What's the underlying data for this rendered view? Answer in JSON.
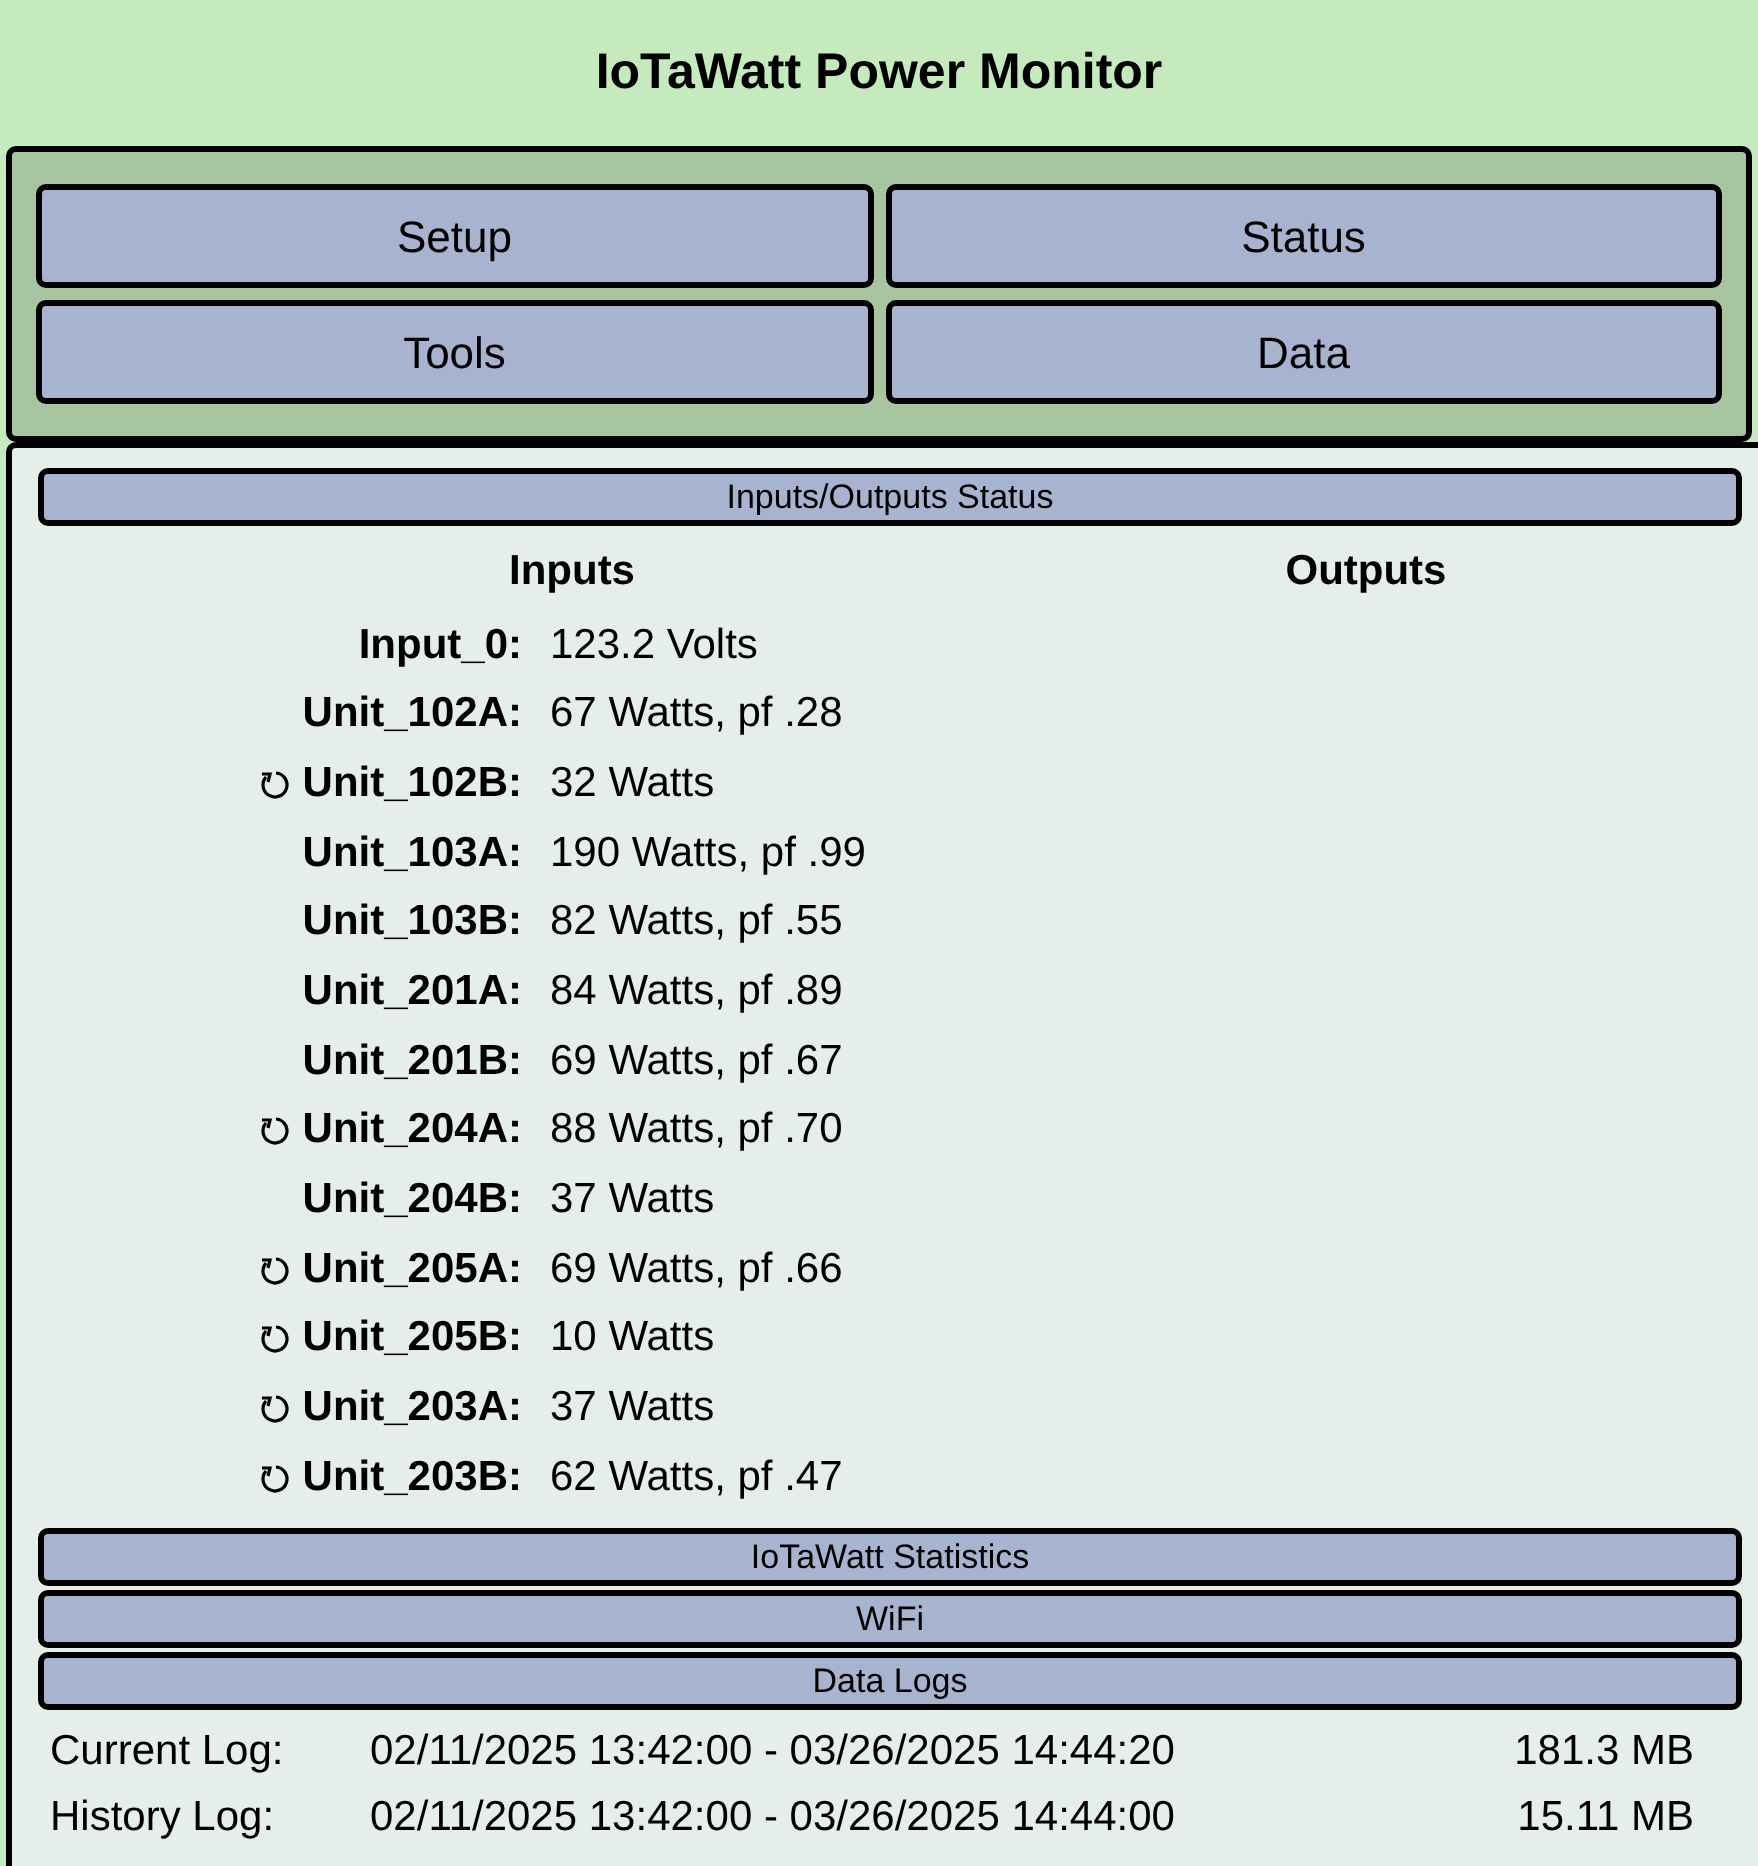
{
  "window": {
    "title": "IoTaWatt Power Monitor"
  },
  "menu": [
    "Setup",
    "Status",
    "Tools",
    "Data"
  ],
  "io_status": {
    "header": "Inputs/Outputs Status",
    "inputs_heading": "Inputs",
    "outputs_heading": "Outputs",
    "inputs": [
      {
        "name": "Input_0:",
        "value": "123.2 Volts",
        "reversed": false
      },
      {
        "name": "Unit_102A:",
        "value": "67 Watts, pf .28",
        "reversed": false
      },
      {
        "name": "Unit_102B:",
        "value": "32 Watts",
        "reversed": true
      },
      {
        "name": "Unit_103A:",
        "value": "190 Watts, pf .99",
        "reversed": false
      },
      {
        "name": "Unit_103B:",
        "value": "82 Watts, pf .55",
        "reversed": false
      },
      {
        "name": "Unit_201A:",
        "value": "84 Watts, pf .89",
        "reversed": false
      },
      {
        "name": "Unit_201B:",
        "value": "69 Watts, pf .67",
        "reversed": false
      },
      {
        "name": "Unit_204A:",
        "value": "88 Watts, pf .70",
        "reversed": true
      },
      {
        "name": "Unit_204B:",
        "value": "37 Watts",
        "reversed": false
      },
      {
        "name": "Unit_205A:",
        "value": "69 Watts, pf .66",
        "reversed": true
      },
      {
        "name": "Unit_205B:",
        "value": "10 Watts",
        "reversed": true
      },
      {
        "name": "Unit_203A:",
        "value": "37 Watts",
        "reversed": true
      },
      {
        "name": "Unit_203B:",
        "value": "62 Watts, pf .47",
        "reversed": true
      }
    ]
  },
  "sections": [
    "IoTaWatt Statistics",
    "WiFi",
    "Data Logs"
  ],
  "logs": [
    {
      "label": "Current Log:",
      "range": "02/11/2025 13:42:00 - 03/26/2025 14:44:20",
      "size": "181.3 MB"
    },
    {
      "label": "History Log:",
      "range": "02/11/2025 13:42:00 - 03/26/2025 14:44:00",
      "size": "15.11 MB"
    }
  ]
}
